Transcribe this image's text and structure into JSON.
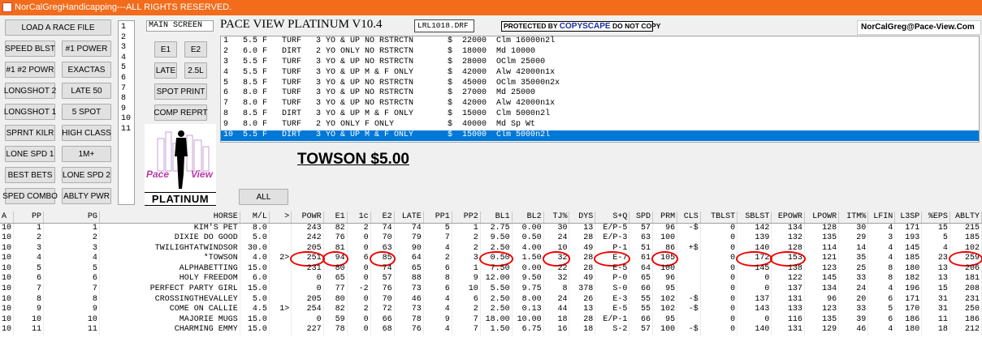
{
  "titlebar": {
    "text": "NorCalGregHandicapping---ALL RIGHTS RESERVED."
  },
  "left_buttons": [
    [
      "LOAD A RACE FILE"
    ],
    [
      "SPEED BLST",
      "#1 POWER"
    ],
    [
      "#1 #2 POWR",
      "EXACTAS"
    ],
    [
      "LONGSHOT 2",
      "LATE 50"
    ],
    [
      "LONGSHOT 1",
      "5 SPOT"
    ],
    [
      "SPRNT KILR",
      "HIGH CLASS"
    ],
    [
      "LONE SPD 1",
      "1M+"
    ],
    [
      "BEST BETS",
      "LONE SPD 2"
    ],
    [
      "SPED COMBO",
      "ABLTY PWR"
    ]
  ],
  "race_numbers": [
    "1",
    "2",
    "3",
    "4",
    "5",
    "6",
    "7",
    "8",
    "9",
    "10",
    "11"
  ],
  "main_screen_label": "MAIN SCREEN",
  "mid_buttons": {
    "e1": "E1",
    "e2": "E2",
    "late": "LATE",
    "p25l": "2.5L",
    "spot_print": "SPOT PRINT",
    "comp_reprt": "COMP REPRT",
    "all": "ALL"
  },
  "app_title": "PACE VIEW PLATINUM V10.4",
  "file_name": "LRL1018.DRF",
  "copyscape": {
    "prefix": "PROTECTED BY ",
    "brand": "COPYSCAPE",
    "suffix": " DO NOT COPY"
  },
  "email": "NorCalGreg@Pace-View.Com",
  "logo": {
    "pace": "Pace",
    "view": "View",
    "platinum": "PLATINUM"
  },
  "races": [
    "1   5.5 F   TURF   3 YO & UP NO RSTRCTN       $  22000  Clm 16000n2l",
    "2   6.0 F   DIRT   2 YO ONLY NO RSTRCTN       $  18000  Md 10000",
    "3   5.5 F   TURF   3 YO & UP NO RSTRCTN       $  28000  OClm 25000",
    "4   5.5 F   TURF   3 YO & UP M & F ONLY       $  42000  Alw 42000n1x",
    "5   8.5 F   TURF   3 YO & UP NO RSTRCTN       $  45000  OClm 35000n2x",
    "6   8.0 F   TURF   3 YO & UP NO RSTRCTN       $  27000  Md 25000",
    "7   8.0 F   TURF   3 YO & UP NO RSTRCTN       $  42000  Alw 42000n1x",
    "8   8.5 F   DIRT   3 YO & UP M & F ONLY       $  15000  Clm 5000n2l",
    "9   8.0 F   TURF   2 YO ONLY F ONLY           $  40000  Md Sp Wt",
    "10  5.5 F   DIRT   3 YO & UP M & F ONLY       $  15000  Clm 5000n2l"
  ],
  "selected_race_index": 9,
  "selected_horse": "TOWSON $5.00",
  "grid": {
    "columns": [
      "A",
      "PP",
      "PG",
      "HORSE",
      "M/L",
      ">",
      "POWR",
      "E1",
      "1c",
      "E2",
      "LATE",
      "PP1",
      "PP2",
      "BL1",
      "BL2",
      "TJ%",
      "DYS",
      "S+Q",
      "SPD",
      "PRM",
      "CLS",
      "TBLST",
      "SBLST",
      "EPOWR",
      "LPOWR",
      "ITM%",
      "LFIN",
      "L3SP",
      "%EPS",
      "ABLTY"
    ],
    "rows": [
      [
        "10",
        "1",
        "1",
        "KIM'S PET",
        "8.0",
        "",
        "243",
        "82",
        "2",
        "74",
        "74",
        "5",
        "1",
        "2.75",
        "0.00",
        "30",
        "13",
        "E/P-5",
        "57",
        "96",
        "-$",
        "0",
        "142",
        "134",
        "128",
        "30",
        "4",
        "171",
        "15",
        "215"
      ],
      [
        "10",
        "2",
        "2",
        "DIXIE DO GOOD",
        "5.0",
        "",
        "242",
        "76",
        "0",
        "70",
        "79",
        "7",
        "2",
        "9.50",
        "0.50",
        "24",
        "28",
        "E/P-3",
        "63",
        "100",
        "",
        "0",
        "139",
        "132",
        "135",
        "29",
        "3",
        "193",
        "5",
        "185"
      ],
      [
        "10",
        "3",
        "3",
        "TWILIGHTATWINDSOR",
        "30.0",
        "",
        "205",
        "81",
        "0",
        "63",
        "90",
        "4",
        "2",
        "2.50",
        "4.00",
        "10",
        "49",
        "P-1",
        "51",
        "86",
        "+$",
        "0",
        "140",
        "128",
        "114",
        "14",
        "4",
        "145",
        "4",
        "102"
      ],
      [
        "10",
        "4",
        "4",
        "*TOWSON",
        "4.0",
        "2>",
        "251",
        "94",
        "6",
        "85",
        "64",
        "2",
        "3",
        "0.50",
        "1.50",
        "32",
        "28",
        "E-7",
        "61",
        "105",
        "",
        "0",
        "172",
        "153",
        "121",
        "35",
        "4",
        "185",
        "23",
        "259"
      ],
      [
        "10",
        "5",
        "5",
        "ALPHABETTING",
        "15.0",
        "",
        "231",
        "80",
        "0",
        "74",
        "65",
        "6",
        "1",
        "7.50",
        "0.00",
        "22",
        "28",
        "E-5",
        "64",
        "100",
        "",
        "0",
        "145",
        "138",
        "123",
        "25",
        "8",
        "180",
        "13",
        "206"
      ],
      [
        "10",
        "6",
        "6",
        "HOLY FREEDOM",
        "6.0",
        "",
        "0",
        "65",
        "0",
        "57",
        "88",
        "8",
        "9",
        "12.00",
        "9.50",
        "32",
        "49",
        "P-0",
        "65",
        "96",
        "",
        "0",
        "0",
        "122",
        "145",
        "33",
        "8",
        "182",
        "13",
        "181"
      ],
      [
        "10",
        "7",
        "7",
        "PERFECT PARTY GIRL",
        "15.0",
        "",
        "0",
        "77",
        "-2",
        "76",
        "73",
        "6",
        "10",
        "5.50",
        "9.75",
        "8",
        "378",
        "S-0",
        "66",
        "95",
        "",
        "0",
        "0",
        "137",
        "134",
        "24",
        "4",
        "196",
        "15",
        "208"
      ],
      [
        "10",
        "8",
        "8",
        "CROSSINGTHEVALLEY",
        "5.0",
        "",
        "205",
        "80",
        "0",
        "70",
        "46",
        "4",
        "6",
        "2.50",
        "8.00",
        "24",
        "26",
        "E-3",
        "55",
        "102",
        "-$",
        "0",
        "137",
        "131",
        "96",
        "20",
        "6",
        "171",
        "31",
        "231"
      ],
      [
        "10",
        "9",
        "9",
        "COME ON CALLIE",
        "4.5",
        "1>",
        "254",
        "82",
        "2",
        "72",
        "73",
        "4",
        "2",
        "2.50",
        "0.13",
        "44",
        "13",
        "E-5",
        "55",
        "102",
        "-$",
        "0",
        "143",
        "133",
        "123",
        "33",
        "5",
        "170",
        "31",
        "250"
      ],
      [
        "10",
        "10",
        "10",
        "MAJORIE MUGS",
        "15.0",
        "",
        "0",
        "59",
        "0",
        "66",
        "78",
        "9",
        "7",
        "18.00",
        "10.00",
        "18",
        "28",
        "E/P-1",
        "66",
        "95",
        "",
        "0",
        "0",
        "116",
        "135",
        "39",
        "6",
        "186",
        "11",
        "186"
      ],
      [
        "10",
        "11",
        "11",
        "CHARMING EMMY",
        "15.0",
        "",
        "227",
        "78",
        "0",
        "68",
        "76",
        "4",
        "7",
        "1.50",
        "6.75",
        "16",
        "18",
        "S-2",
        "57",
        "100",
        "-$",
        "0",
        "140",
        "131",
        "129",
        "46",
        "4",
        "180",
        "18",
        "212"
      ]
    ],
    "highlighted_row": 3,
    "highlighted_columns": [
      "POWR",
      "E1",
      "E2",
      "BL1",
      "TJ%",
      "S+Q",
      "PRM",
      "SBLST",
      "EPOWR",
      "ABLTY"
    ]
  }
}
